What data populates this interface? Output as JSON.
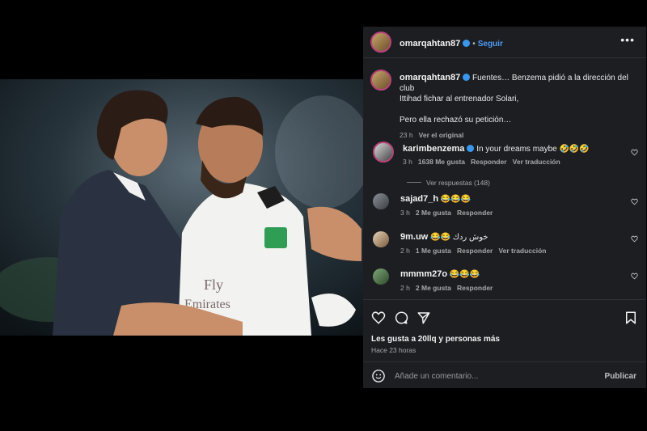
{
  "post": {
    "username": "omarqahtan87",
    "follow_label": "Seguir",
    "caption_user": "omarqahtan87",
    "caption_line1": "Fuentes… Benzema pidió a la dirección del club",
    "caption_line2": "Ittihad fichar al entrenador Solari,",
    "caption_line3": "Pero ella rechazó su petición…",
    "caption_time": "23 h",
    "see_original": "Ver el original"
  },
  "comments": [
    {
      "user": "karimbenzema",
      "text": "In your dreams maybe 🤣🤣🤣",
      "time": "3 h",
      "likes": "1638 Me gusta",
      "reply": "Responder",
      "translate": "Ver traducción",
      "view_replies": "Ver respuestas (148)"
    },
    {
      "user": "sajad7_h",
      "text": "😂😂😂",
      "time": "3 h",
      "likes": "2 Me gusta",
      "reply": "Responder"
    },
    {
      "user": "9m.uw",
      "text": "😂😂 خوش ردك",
      "time": "2 h",
      "likes": "1 Me gusta",
      "reply": "Responder",
      "translate": "Ver traducción"
    },
    {
      "user": "mmmm27o",
      "text": "😂😂😂",
      "time": "2 h",
      "likes": "2 Me gusta",
      "reply": "Responder"
    }
  ],
  "likes_text": "Les gusta a 20llq y personas más",
  "posted_ago": "Hace 23 horas",
  "comment_placeholder": "Añade un comentario...",
  "publish_label": "Publicar",
  "icons": [
    "more-icon",
    "heart-icon",
    "comment-icon",
    "share-icon",
    "bookmark-icon",
    "emoji-icon",
    "verified-icon"
  ],
  "colors": {
    "accent": "#4f9cf7",
    "panel": "#1c1e22",
    "verified": "#3897f0"
  }
}
